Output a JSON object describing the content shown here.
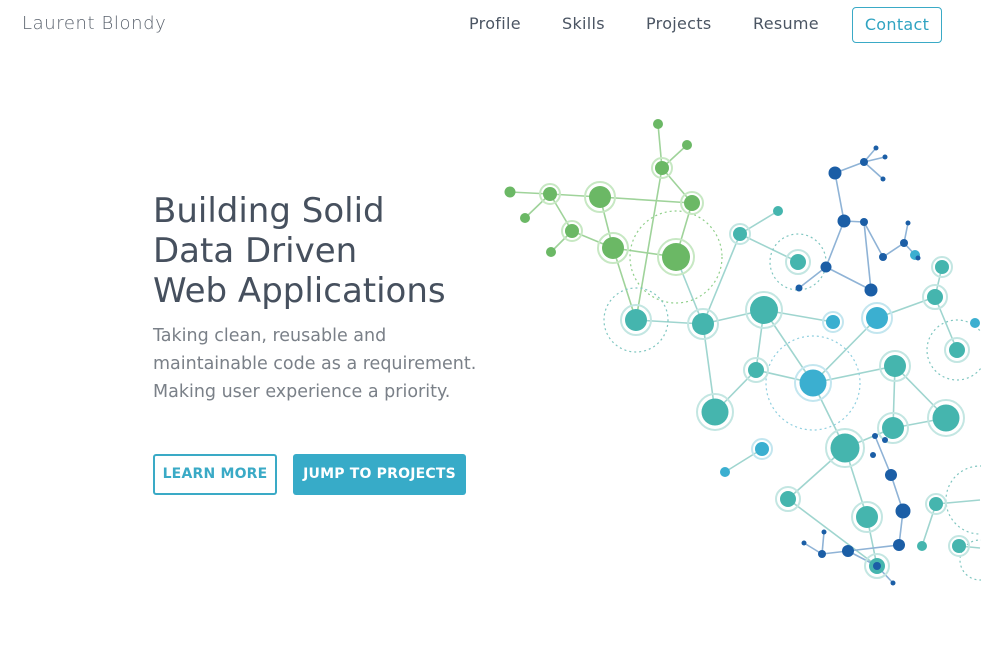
{
  "header": {
    "brand": "Laurent Blondy",
    "nav": [
      {
        "label": "Profile"
      },
      {
        "label": "Skills"
      },
      {
        "label": "Projects"
      },
      {
        "label": "Resume"
      }
    ],
    "contact_label": "Contact"
  },
  "hero": {
    "title_lines": [
      "Building Solid",
      "Data Driven",
      "Web Applications"
    ],
    "subtitle_lines": [
      "Taking clean, reusable and",
      "maintainable code as a requirement.",
      "Making user experience a priority."
    ],
    "learn_more_label": "LEARN MORE",
    "jump_label": "JUMP TO PROJECTS"
  },
  "colors": {
    "accent": "#37abc8",
    "green": "#6bb865",
    "teal": "#45b5ae",
    "cyan": "#3bafd0",
    "navy": "#1b5ea6",
    "text": "#46505e"
  },
  "illustration": {
    "icon": "molecular-network-graphic"
  }
}
